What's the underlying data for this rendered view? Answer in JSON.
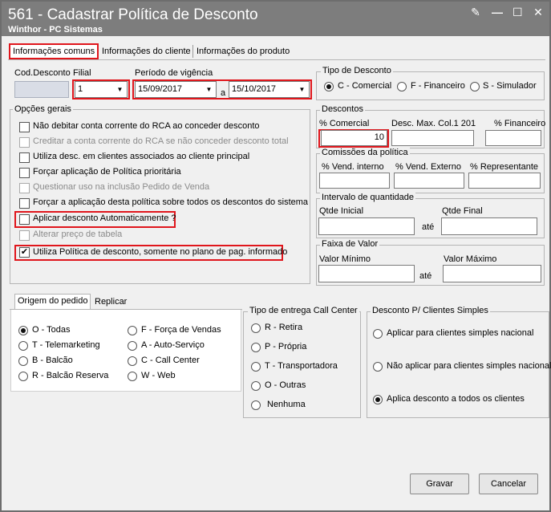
{
  "window": {
    "title": "561 - Cadastrar Política de Desconto",
    "subtitle": "Winthor - PC Sistemas",
    "icons": [
      "edit-icon",
      "minimize-icon",
      "maximize-icon",
      "close-icon"
    ],
    "icon_glyphs": [
      "✎",
      "—",
      "☐",
      "✕"
    ]
  },
  "tabs": [
    {
      "label": "Informações comuns",
      "active": true
    },
    {
      "label": "Informações do cliente",
      "active": false
    },
    {
      "label": "Informações do produto",
      "active": false
    }
  ],
  "header": {
    "cod_desconto_label": "Cod.Desconto",
    "cod_desconto_value": "",
    "filial_label": "Filial",
    "filial_value": "1",
    "periodo_label": "Período de vigência",
    "periodo_start": "15/09/2017",
    "periodo_sep": "a",
    "periodo_end": "15/10/2017"
  },
  "tipo_desconto": {
    "label": "Tipo de Desconto",
    "options": [
      {
        "label": "C - Comercial",
        "selected": true
      },
      {
        "label": "F - Financeiro",
        "selected": false
      },
      {
        "label": "S - Simulador",
        "selected": false
      }
    ]
  },
  "opcoes_gerais": {
    "label": "Opções gerais",
    "items": [
      {
        "label": "Não debitar conta corrente do RCA ao conceder desconto",
        "checked": false,
        "enabled": true
      },
      {
        "label": "Creditar a conta corrente do RCA se não conceder desconto total",
        "checked": false,
        "enabled": false
      },
      {
        "label": "Utiliza desc. em clientes associados ao cliente principal",
        "checked": false,
        "enabled": true
      },
      {
        "label": "Forçar aplicação de Política prioritária",
        "checked": false,
        "enabled": true
      },
      {
        "label": "Questionar uso na inclusão Pedido de Venda",
        "checked": false,
        "enabled": false
      },
      {
        "label": "Forçar a aplicação desta política sobre todos os descontos do sistema",
        "checked": false,
        "enabled": true
      },
      {
        "label": "Aplicar desconto Automaticamente ?",
        "checked": false,
        "enabled": true
      },
      {
        "label": "Alterar preço de tabela",
        "checked": false,
        "enabled": false
      },
      {
        "label": "Utiliza Política de desconto, somente no plano de pag. informado",
        "checked": true,
        "enabled": true
      }
    ],
    "check_glyph": "✔"
  },
  "descontos": {
    "label": "Descontos",
    "comercial_label": "% Comercial",
    "comercial_value": "10",
    "desc_max_label": "Desc. Max. Col.1 201",
    "desc_max_value": "",
    "financeiro_label": "% Financeiro",
    "financeiro_value": ""
  },
  "comissoes": {
    "label": "Comissões da política",
    "vend_interno_label": "% Vend. interno",
    "vend_externo_label": "% Vend. Externo",
    "representante_label": "% Representante"
  },
  "intervalo": {
    "label": "Intervalo de quantidade",
    "inicial_label": "Qtde Inicial",
    "final_label": "Qtde Final",
    "ate": "até"
  },
  "faixa_valor": {
    "label": "Faixa de Valor",
    "minimo_label": "Valor Mínimo",
    "maximo_label": "Valor Máximo",
    "ate": "até"
  },
  "bottom_tabs": [
    {
      "label": "Origem do pedido",
      "active": true
    },
    {
      "label": "Replicar",
      "active": false
    }
  ],
  "origem": {
    "left": [
      {
        "label": "O - Todas",
        "selected": true
      },
      {
        "label": "T - Telemarketing",
        "selected": false
      },
      {
        "label": "B - Balcão",
        "selected": false
      },
      {
        "label": "R - Balcão Reserva",
        "selected": false
      }
    ],
    "right": [
      {
        "label": "F - Força de Vendas",
        "selected": false
      },
      {
        "label": "A - Auto-Serviço",
        "selected": false
      },
      {
        "label": "C - Call Center",
        "selected": false
      },
      {
        "label": "W - Web",
        "selected": false
      }
    ]
  },
  "tipo_entrega": {
    "label": "Tipo de entrega Call Center",
    "options": [
      {
        "label": "R - Retira",
        "selected": false
      },
      {
        "label": "P - Própria",
        "selected": false
      },
      {
        "label": "T - Transportadora",
        "selected": false
      },
      {
        "label": "O - Outras",
        "selected": false
      },
      {
        "label": "Nenhuma",
        "selected": false
      }
    ]
  },
  "desconto_simples": {
    "label": "Desconto P/ Clientes Simples",
    "options": [
      {
        "label": "Aplicar para clientes simples nacional",
        "selected": false
      },
      {
        "label": "Não aplicar para clientes simples nacional",
        "selected": false
      },
      {
        "label": "Aplica desconto a todos os clientes",
        "selected": true
      }
    ]
  },
  "actions": {
    "gravar": "Gravar",
    "cancelar": "Cancelar"
  },
  "colors": {
    "highlight": "#e0161c",
    "titlebar": "#7d7d7d"
  }
}
